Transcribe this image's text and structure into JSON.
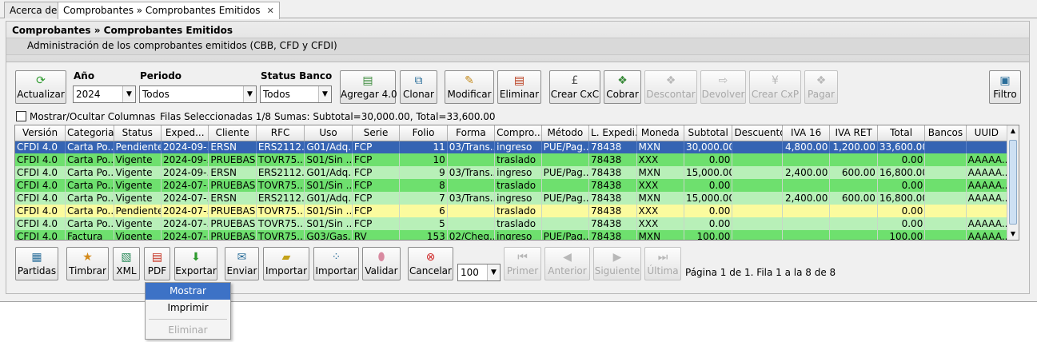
{
  "tabs": [
    {
      "label": "Acerca de"
    },
    {
      "label": "Comprobantes » Comprobantes Emitidos",
      "close": "✕"
    }
  ],
  "header": {
    "title": "Comprobantes » Comprobantes Emitidos",
    "subtitle": "Administración de los comprobantes emitidos (CBB, CFD y CFDI)"
  },
  "toolbar": {
    "actualizar": "Actualizar",
    "anio_label": "Año",
    "anio_value": "2024",
    "periodo_label": "Periodo",
    "periodo_value": "Todos",
    "status_banco_label": "Status Banco",
    "status_banco_value": "Todos",
    "agregar": "Agregar 4.0",
    "clonar": "Clonar",
    "modificar": "Modificar",
    "eliminar": "Eliminar",
    "crear_cxc": "Crear CxC",
    "cobrar": "Cobrar",
    "descontar": "Descontar",
    "devolver": "Devolver",
    "crear_cxp": "Crear CxP",
    "pagar": "Pagar",
    "filtro": "Filtro"
  },
  "info": {
    "mostrar_columnas": "Mostrar/Ocultar Columnas",
    "filas_seleccionadas": "Filas Seleccionadas  1/8",
    "sumas": "Sumas:  Subtotal=30,000.00, Total=33,600.00"
  },
  "table": {
    "columns": [
      "Versión",
      "Categoria",
      "Status",
      "Exped...",
      "Cliente",
      "RFC",
      "Uso",
      "Serie",
      "Folio",
      "Forma",
      "Compro...",
      "Método",
      "L. Expedi...",
      "Moneda",
      "Subtotal",
      "Descuento",
      "IVA 16",
      "IVA RET",
      "Total",
      "Bancos",
      "UUID"
    ],
    "rows": [
      {
        "style": "sel",
        "cells": [
          "CFDI 4.0",
          "Carta Po...",
          "Pendiente",
          "2024-09-...",
          "ERSN",
          "ERS2112...",
          "G01/Adq...",
          "FCP",
          "11",
          "03/Trans...",
          "ingreso",
          "PUE/Pag...",
          "78438",
          "MXN",
          "30,000.00",
          "",
          "4,800.00",
          "1,200.00",
          "33,600.00",
          "",
          ""
        ]
      },
      {
        "style": "green",
        "cells": [
          "CFDI 4.0",
          "Carta Po...",
          "Vigente",
          "2024-09-...",
          "PRUEBAS",
          "TOVR75...",
          "S01/Sin ...",
          "FCP",
          "10",
          "",
          "traslado",
          "",
          "78438",
          "XXX",
          "0.00",
          "",
          "",
          "",
          "0.00",
          "",
          "AAAAA..."
        ]
      },
      {
        "style": "lgreen",
        "cells": [
          "CFDI 4.0",
          "Carta Po...",
          "Vigente",
          "2024-09-...",
          "ERSN",
          "ERS2112...",
          "G01/Adq...",
          "FCP",
          "9",
          "03/Trans...",
          "ingreso",
          "PUE/Pag...",
          "78438",
          "MXN",
          "15,000.00",
          "",
          "2,400.00",
          "600.00",
          "16,800.00",
          "",
          "AAAAA..."
        ]
      },
      {
        "style": "green",
        "cells": [
          "CFDI 4.0",
          "Carta Po...",
          "Vigente",
          "2024-07-...",
          "PRUEBAS",
          "TOVR75...",
          "S01/Sin ...",
          "FCP",
          "8",
          "",
          "traslado",
          "",
          "78438",
          "XXX",
          "0.00",
          "",
          "",
          "",
          "0.00",
          "",
          "AAAAA..."
        ]
      },
      {
        "style": "lgreen",
        "cells": [
          "CFDI 4.0",
          "Carta Po...",
          "Vigente",
          "2024-07-...",
          "ERSN",
          "ERS2112...",
          "G01/Adq...",
          "FCP",
          "7",
          "03/Trans...",
          "ingreso",
          "PUE/Pag...",
          "78438",
          "MXN",
          "15,000.00",
          "",
          "2,400.00",
          "600.00",
          "16,800.00",
          "",
          "AAAAA..."
        ]
      },
      {
        "style": "yellow",
        "cells": [
          "CFDI 4.0",
          "Carta Po...",
          "Pendiente",
          "2024-07-...",
          "PRUEBAS",
          "TOVR75...",
          "S01/Sin ...",
          "FCP",
          "6",
          "",
          "traslado",
          "",
          "78438",
          "XXX",
          "0.00",
          "",
          "",
          "",
          "0.00",
          "",
          ""
        ]
      },
      {
        "style": "lgreen",
        "cells": [
          "CFDI 4.0",
          "Carta Po...",
          "Vigente",
          "2024-07-...",
          "PRUEBAS",
          "TOVR75...",
          "S01/Sin ...",
          "FCP",
          "5",
          "",
          "traslado",
          "",
          "78438",
          "XXX",
          "0.00",
          "",
          "",
          "",
          "0.00",
          "",
          "AAAAA..."
        ]
      },
      {
        "style": "green",
        "cells": [
          "CFDI 4.0",
          "Factura",
          "Vigente",
          "2024-07-...",
          "PRUEBAS",
          "TOVR75...",
          "G03/Gas...",
          "RV",
          "153",
          "02/Cheq...",
          "ingreso",
          "PUE/Pag...",
          "78438",
          "MXN",
          "100.00",
          "",
          "",
          "",
          "100.00",
          "",
          "AAAAA..."
        ]
      }
    ]
  },
  "bottom": {
    "partidas": "Partidas",
    "timbrar": "Timbrar",
    "xml": "XML",
    "pdf": "PDF",
    "exportar": "Exportar",
    "enviar": "Enviar",
    "importar1": "Importar",
    "importar2": "Importar",
    "validar": "Validar",
    "cancelar": "Cancelar",
    "page_size": "100",
    "primer": "Primer",
    "anterior": "Anterior",
    "siguiente": "Siguiente",
    "ultima": "Última",
    "page_info": "Página 1 de 1. Fila 1 a la 8 de 8"
  },
  "menu": {
    "mostrar": "Mostrar",
    "imprimir": "Imprimir",
    "eliminar": "Eliminar"
  },
  "colors": {
    "selected_row": "#3564b3",
    "vigente_row": "#6ee06e",
    "vigente_alt_row": "#b8f0b8",
    "pendiente_row": "#fbfb9e"
  }
}
